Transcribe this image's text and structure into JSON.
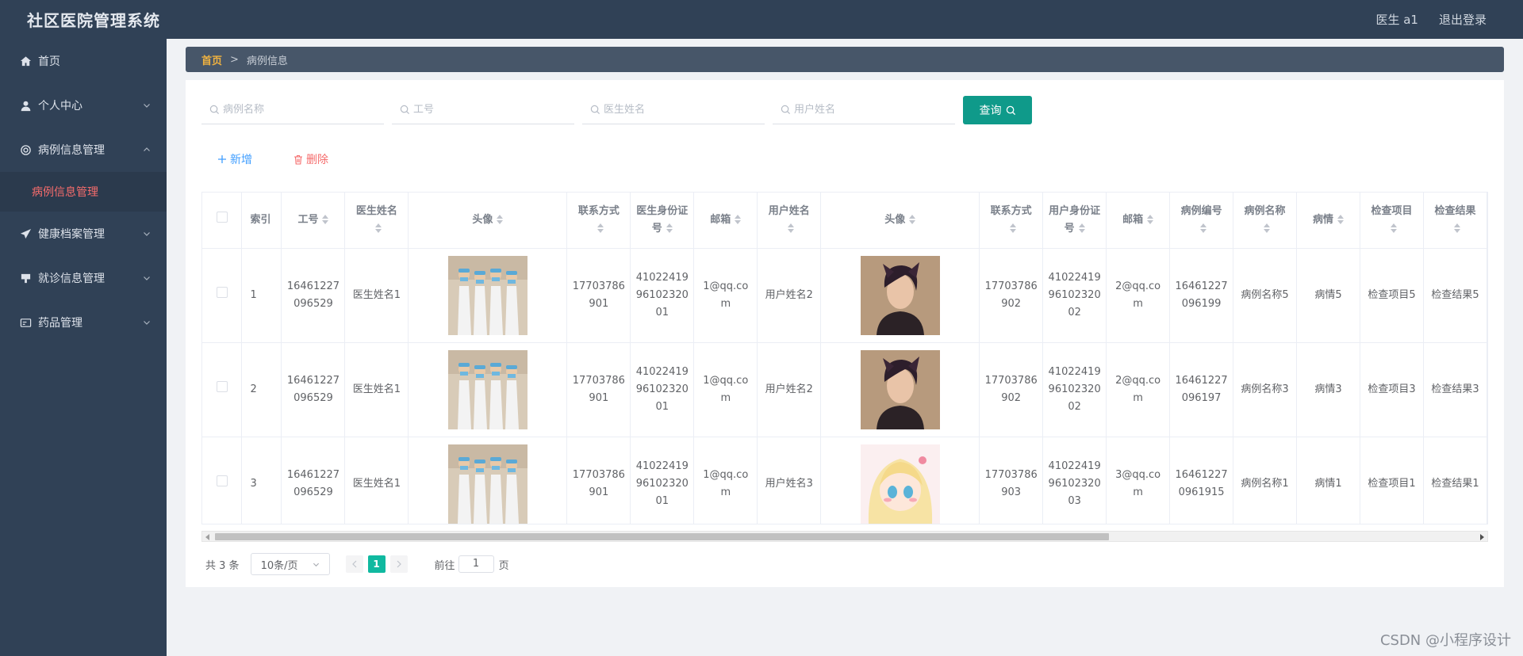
{
  "app": {
    "title": "社区医院管理系统",
    "user": "医生 a1",
    "logout": "退出登录"
  },
  "sidebar": {
    "items": [
      {
        "label": "首页",
        "icon": "home-icon",
        "expandable": false
      },
      {
        "label": "个人中心",
        "icon": "user-icon",
        "expandable": true
      },
      {
        "label": "病例信息管理",
        "icon": "settings-icon",
        "expandable": true,
        "expanded": true
      },
      {
        "label": "健康档案管理",
        "icon": "send-icon",
        "expandable": true
      },
      {
        "label": "就诊信息管理",
        "icon": "stamp-icon",
        "expandable": true
      },
      {
        "label": "药品管理",
        "icon": "card-icon",
        "expandable": true
      }
    ],
    "active_sub": "病例信息管理"
  },
  "breadcrumb": {
    "home": "首页",
    "separator": ">",
    "current": "病例信息"
  },
  "search": {
    "placeholders": [
      "病例名称",
      "工号",
      "医生姓名",
      "用户姓名"
    ],
    "query_label": "查询"
  },
  "actions": {
    "add": "新增",
    "delete": "删除"
  },
  "table": {
    "headers": [
      "索引",
      "工号",
      "医生姓名",
      "头像",
      "联系方式",
      "医生身份证号",
      "邮箱",
      "用户姓名",
      "头像",
      "联系方式",
      "用户身份证号",
      "邮箱",
      "病例编号",
      "病例名称",
      "病情",
      "检查项目",
      "检查结果"
    ],
    "rows": [
      {
        "index": "1",
        "job_no": "16461227096529",
        "doctor_name": "医生姓名1",
        "doctor_avatar": "doctors-photo",
        "doctor_phone": "17703786901",
        "doctor_id_no": "410224199610232001",
        "doctor_email": "1@qq.com",
        "user_name": "用户姓名2",
        "user_avatar": "man-photo",
        "user_phone": "17703786902",
        "user_id_no": "410224199610232002",
        "user_email": "2@qq.com",
        "case_no": "16461227096199",
        "case_name": "病例名称5",
        "condition": "病情5",
        "check_item": "检查项目5",
        "check_result": "检查结果5"
      },
      {
        "index": "2",
        "job_no": "16461227096529",
        "doctor_name": "医生姓名1",
        "doctor_avatar": "doctors-photo",
        "doctor_phone": "17703786901",
        "doctor_id_no": "410224199610232001",
        "doctor_email": "1@qq.com",
        "user_name": "用户姓名2",
        "user_avatar": "man-photo",
        "user_phone": "17703786902",
        "user_id_no": "410224199610232002",
        "user_email": "2@qq.com",
        "case_no": "16461227096197",
        "case_name": "病例名称3",
        "condition": "病情3",
        "check_item": "检查项目3",
        "check_result": "检查结果3"
      },
      {
        "index": "3",
        "job_no": "16461227096529",
        "doctor_name": "医生姓名1",
        "doctor_avatar": "doctors-photo",
        "doctor_phone": "17703786901",
        "doctor_id_no": "410224199610232001",
        "doctor_email": "1@qq.com",
        "user_name": "用户姓名3",
        "user_avatar": "anime-photo",
        "user_phone": "17703786903",
        "user_id_no": "410224199610232003",
        "user_email": "3@qq.com",
        "case_no": "164612270961915",
        "case_name": "病例名称1",
        "condition": "病情1",
        "check_item": "检查项目1",
        "check_result": "检查结果1"
      }
    ]
  },
  "pagination": {
    "total": "共 3 条",
    "page_size": "10条/页",
    "current": "1",
    "goto_prefix": "前往",
    "goto_value": "1",
    "goto_suffix": "页"
  },
  "watermark": "CSDN @小程序设计",
  "colors": {
    "header_bg": "#304156",
    "accent": "#0f9a8a",
    "active_page": "#10b9a0",
    "danger": "#f56c6c",
    "primary": "#409eff",
    "breadcrumb_home": "#f0b240"
  }
}
